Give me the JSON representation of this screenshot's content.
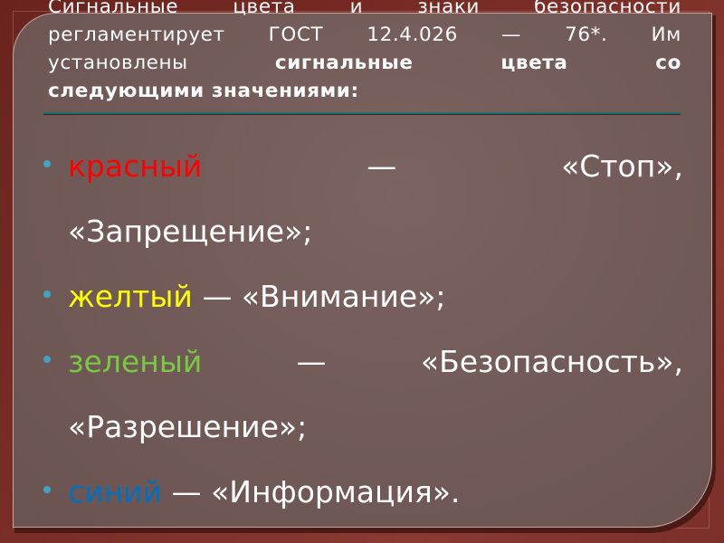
{
  "slide": {
    "title": {
      "line1": "Сигнальные цвета и знаки безопасности",
      "line2": "регламентирует ГОСТ 12.4.026 — 76*. Им",
      "line3_normal": "установлены",
      "line3_bold": "сигнальные цвета со",
      "line4_bold": "следующими значениями:"
    },
    "items": [
      {
        "keyword": "красный",
        "keyword_color": "#ff0000",
        "dash": "—",
        "meaning_line1": "«Стоп»,",
        "meaning_line2": "«Запрещение»;"
      },
      {
        "keyword": "желтый",
        "keyword_color": "#ffff00",
        "dash": "—",
        "meaning_line1": "«Внимание»;"
      },
      {
        "keyword": "зеленый",
        "keyword_color": "#7ac943",
        "dash": "—",
        "meaning_line1": "«Безопасность»,",
        "meaning_line2": "«Разрешение»;"
      },
      {
        "keyword": "синий",
        "keyword_color": "#0070c0",
        "dash": "—",
        "meaning_line1": "«Информация»."
      }
    ],
    "colors": {
      "frame": "#7a2e27",
      "panel": "#735b58",
      "rule": "#1e6e72",
      "bullet": "#3fa4c4",
      "text": "#ffffff"
    }
  }
}
